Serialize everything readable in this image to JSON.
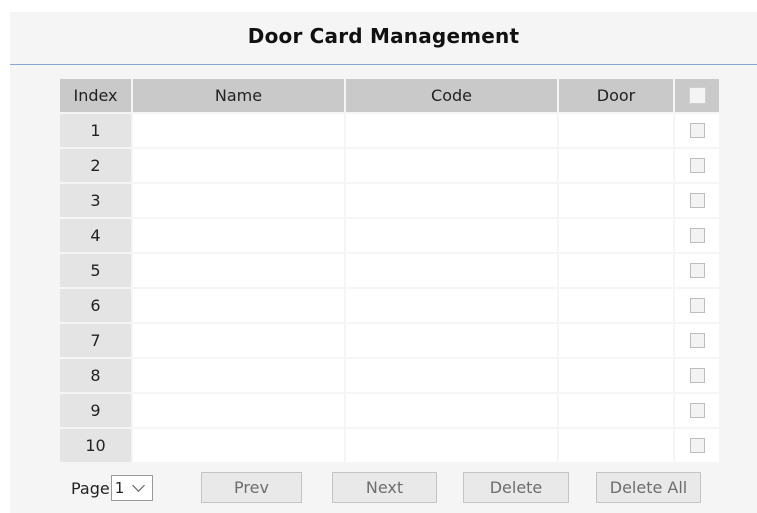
{
  "title": "Door Card Management",
  "table": {
    "headers": [
      "Index",
      "Name",
      "Code",
      "Door"
    ],
    "rows": [
      {
        "index": "1",
        "name": "",
        "code": "",
        "door": ""
      },
      {
        "index": "2",
        "name": "",
        "code": "",
        "door": ""
      },
      {
        "index": "3",
        "name": "",
        "code": "",
        "door": ""
      },
      {
        "index": "4",
        "name": "",
        "code": "",
        "door": ""
      },
      {
        "index": "5",
        "name": "",
        "code": "",
        "door": ""
      },
      {
        "index": "6",
        "name": "",
        "code": "",
        "door": ""
      },
      {
        "index": "7",
        "name": "",
        "code": "",
        "door": ""
      },
      {
        "index": "8",
        "name": "",
        "code": "",
        "door": ""
      },
      {
        "index": "9",
        "name": "",
        "code": "",
        "door": ""
      },
      {
        "index": "10",
        "name": "",
        "code": "",
        "door": ""
      }
    ]
  },
  "pager": {
    "label": "Page",
    "selected_page": "1",
    "prev": "Prev",
    "next": "Next",
    "delete": "Delete",
    "delete_all": "Delete All"
  },
  "colors": {
    "header_bg": "#c9c9c9",
    "index_bg": "#e4e4e4",
    "panel_bg": "#f5f5f5",
    "title_rule": "#8aa5cf"
  }
}
